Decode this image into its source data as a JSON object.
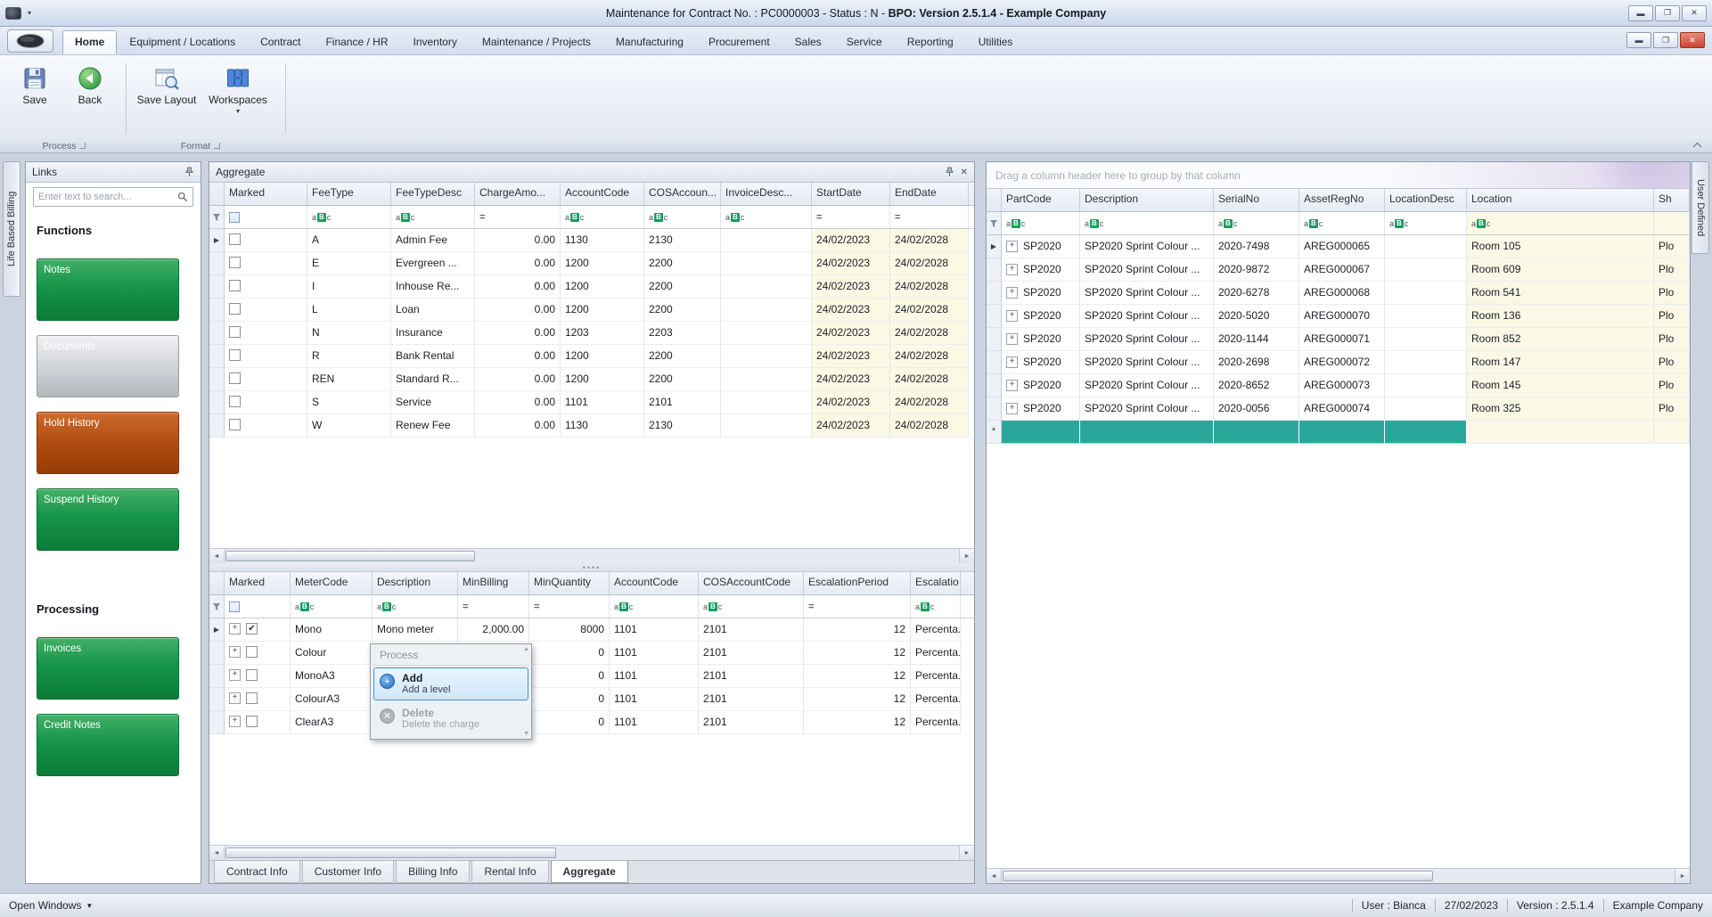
{
  "titlebar": {
    "title_plain": "Maintenance for Contract No. : PC0000003 - Status : N - ",
    "title_bold": "BPO: Version 2.5.1.4 - Example Company"
  },
  "icons": {
    "minimize": "▬",
    "maximize": "❐",
    "close": "✕",
    "caret_down": "▾",
    "caret_down_big": "▼",
    "scroll_left": "◄",
    "scroll_right": "►",
    "menu_up": "▲",
    "menu_down": "▼",
    "plus": "+",
    "collapse": "︿"
  },
  "ribbon": {
    "tabs": [
      {
        "label": "Home",
        "state": "active"
      },
      {
        "label": "Equipment / Locations",
        "state": ""
      },
      {
        "label": "Contract",
        "state": ""
      },
      {
        "label": "Finance / HR",
        "state": ""
      },
      {
        "label": "Inventory",
        "state": ""
      },
      {
        "label": "Maintenance / Projects",
        "state": ""
      },
      {
        "label": "Manufacturing",
        "state": ""
      },
      {
        "label": "Procurement",
        "state": ""
      },
      {
        "label": "Sales",
        "state": ""
      },
      {
        "label": "Service",
        "state": ""
      },
      {
        "label": "Reporting",
        "state": ""
      },
      {
        "label": "Utilities",
        "state": ""
      }
    ],
    "buttons": {
      "save": "Save",
      "back": "Back",
      "save_layout": "Save Layout",
      "workspaces": "Workspaces"
    },
    "groups": {
      "process": "Process",
      "format": "Format"
    }
  },
  "side_strips": {
    "left": "Life Based Billing",
    "right": "User Defined"
  },
  "links_panel": {
    "title": "Links",
    "search_placeholder": "Enter text to search...",
    "functions_heading": "Functions",
    "processing_heading": "Processing",
    "function_buttons": [
      {
        "label": "Notes",
        "style": "green"
      },
      {
        "label": "Documents",
        "style": "silver"
      },
      {
        "label": "Hold History",
        "style": "orange"
      },
      {
        "label": "Suspend History",
        "style": "green"
      }
    ],
    "processing_buttons": [
      {
        "label": "Invoices",
        "style": "green"
      },
      {
        "label": "Credit Notes",
        "style": "green"
      }
    ]
  },
  "aggregate_panel": {
    "title": "Aggregate",
    "fee_grid": {
      "columns": [
        "Marked",
        "FeeType",
        "FeeTypeDesc",
        "ChargeAmo...",
        "AccountCode",
        "COSAccoun...",
        "InvoiceDesc...",
        "StartDate",
        "EndDate"
      ],
      "rows": [
        {
          "sel": "▶",
          "check": "",
          "feetype": "A",
          "desc": "Admin Fee",
          "charge": "0.00",
          "account": "1130",
          "cos": "2130",
          "invoice": "",
          "start": "24/02/2023",
          "end": "24/02/2028"
        },
        {
          "sel": "",
          "check": "",
          "feetype": "E",
          "desc": "Evergreen ...",
          "charge": "0.00",
          "account": "1200",
          "cos": "2200",
          "invoice": "",
          "start": "24/02/2023",
          "end": "24/02/2028"
        },
        {
          "sel": "",
          "check": "",
          "feetype": "I",
          "desc": "Inhouse Re...",
          "charge": "0.00",
          "account": "1200",
          "cos": "2200",
          "invoice": "",
          "start": "24/02/2023",
          "end": "24/02/2028"
        },
        {
          "sel": "",
          "check": "",
          "feetype": "L",
          "desc": "Loan",
          "charge": "0.00",
          "account": "1200",
          "cos": "2200",
          "invoice": "",
          "start": "24/02/2023",
          "end": "24/02/2028"
        },
        {
          "sel": "",
          "check": "",
          "feetype": "N",
          "desc": "Insurance",
          "charge": "0.00",
          "account": "1203",
          "cos": "2203",
          "invoice": "",
          "start": "24/02/2023",
          "end": "24/02/2028"
        },
        {
          "sel": "",
          "check": "",
          "feetype": "R",
          "desc": "Bank Rental",
          "charge": "0.00",
          "account": "1200",
          "cos": "2200",
          "invoice": "",
          "start": "24/02/2023",
          "end": "24/02/2028"
        },
        {
          "sel": "",
          "check": "",
          "feetype": "REN",
          "desc": "Standard R...",
          "charge": "0.00",
          "account": "1200",
          "cos": "2200",
          "invoice": "",
          "start": "24/02/2023",
          "end": "24/02/2028"
        },
        {
          "sel": "",
          "check": "",
          "feetype": "S",
          "desc": "Service",
          "charge": "0.00",
          "account": "1101",
          "cos": "2101",
          "invoice": "",
          "start": "24/02/2023",
          "end": "24/02/2028"
        },
        {
          "sel": "",
          "check": "",
          "feetype": "W",
          "desc": "Renew Fee",
          "charge": "0.00",
          "account": "1130",
          "cos": "2130",
          "invoice": "",
          "start": "24/02/2023",
          "end": "24/02/2028"
        }
      ]
    },
    "meter_grid": {
      "columns": [
        "Marked",
        "MeterCode",
        "Description",
        "MinBilling",
        "MinQuantity",
        "AccountCode",
        "COSAccountCode",
        "EscalationPeriod",
        "Escalatio"
      ],
      "rows": [
        {
          "sel": "▶",
          "check": "✔",
          "meter": "Mono",
          "desc": "Mono meter",
          "minbilling": "2,000.00",
          "minqty": "8000",
          "account": "1101",
          "cos": "2101",
          "period": "12",
          "esc": "Percenta..."
        },
        {
          "sel": "",
          "check": "",
          "meter": "Colour",
          "desc": "",
          "minbilling": "",
          "minqty": "0",
          "account": "1101",
          "cos": "2101",
          "period": "12",
          "esc": "Percenta..."
        },
        {
          "sel": "",
          "check": "",
          "meter": "MonoA3",
          "desc": "",
          "minbilling": "",
          "minqty": "0",
          "account": "1101",
          "cos": "2101",
          "period": "12",
          "esc": "Percenta..."
        },
        {
          "sel": "",
          "check": "",
          "meter": "ColourA3",
          "desc": "",
          "minbilling": "",
          "minqty": "0",
          "account": "1101",
          "cos": "2101",
          "period": "12",
          "esc": "Percenta..."
        },
        {
          "sel": "",
          "check": "",
          "meter": "ClearA3",
          "desc": "",
          "minbilling": "",
          "minqty": "0",
          "account": "1101",
          "cos": "2101",
          "period": "12",
          "esc": "Percenta..."
        }
      ]
    },
    "tabs": [
      {
        "label": "Contract Info",
        "state": ""
      },
      {
        "label": "Customer Info",
        "state": ""
      },
      {
        "label": "Billing Info",
        "state": ""
      },
      {
        "label": "Rental Info",
        "state": ""
      },
      {
        "label": "Aggregate",
        "state": "active"
      }
    ]
  },
  "context_menu": {
    "header": "Process",
    "add_label": "Add",
    "add_desc": "Add a level",
    "delete_label": "Delete",
    "delete_desc": "Delete the charge"
  },
  "equipment_panel": {
    "group_hint": "Drag a column header here to group by that column",
    "columns": [
      "PartCode",
      "Description",
      "SerialNo",
      "AssetRegNo",
      "LocationDesc",
      "Location",
      "Sh"
    ],
    "rows": [
      {
        "sel": "▶",
        "part": "SP2020",
        "desc": "SP2020 Sprint Colour ...",
        "serial": "2020-7498",
        "asset": "AREG000065",
        "locdesc": "",
        "location": "Room 105",
        "sh": "Plo"
      },
      {
        "sel": "",
        "part": "SP2020",
        "desc": "SP2020 Sprint Colour ...",
        "serial": "2020-9872",
        "asset": "AREG000067",
        "locdesc": "",
        "location": "Room 609",
        "sh": "Plo"
      },
      {
        "sel": "",
        "part": "SP2020",
        "desc": "SP2020 Sprint Colour ...",
        "serial": "2020-6278",
        "asset": "AREG000068",
        "locdesc": "",
        "location": "Room 541",
        "sh": "Plo"
      },
      {
        "sel": "",
        "part": "SP2020",
        "desc": "SP2020 Sprint Colour ...",
        "serial": "2020-5020",
        "asset": "AREG000070",
        "locdesc": "",
        "location": "Room 136",
        "sh": "Plo"
      },
      {
        "sel": "",
        "part": "SP2020",
        "desc": "SP2020 Sprint Colour ...",
        "serial": "2020-1144",
        "asset": "AREG000071",
        "locdesc": "",
        "location": "Room 852",
        "sh": "Plo"
      },
      {
        "sel": "",
        "part": "SP2020",
        "desc": "SP2020 Sprint Colour ...",
        "serial": "2020-2698",
        "asset": "AREG000072",
        "locdesc": "",
        "location": "Room 147",
        "sh": "Plo"
      },
      {
        "sel": "",
        "part": "SP2020",
        "desc": "SP2020 Sprint Colour ...",
        "serial": "2020-8652",
        "asset": "AREG000073",
        "locdesc": "",
        "location": "Room 145",
        "sh": "Plo"
      },
      {
        "sel": "",
        "part": "SP2020",
        "desc": "SP2020 Sprint Colour ...",
        "serial": "2020-0056",
        "asset": "AREG000074",
        "locdesc": "",
        "location": "Room 325",
        "sh": "Plo"
      }
    ],
    "new_row_marker": "*"
  },
  "statusbar": {
    "open_windows": "Open Windows",
    "user": "User : Bianca",
    "date": "27/02/2023",
    "version": "Version : 2.5.1.4",
    "company": "Example Company"
  },
  "colors": {
    "accent_green": "#169549",
    "accent_orange": "#b34f12",
    "newrow_teal": "#2aa79b",
    "cell_yellow": "#fbf8e4"
  }
}
